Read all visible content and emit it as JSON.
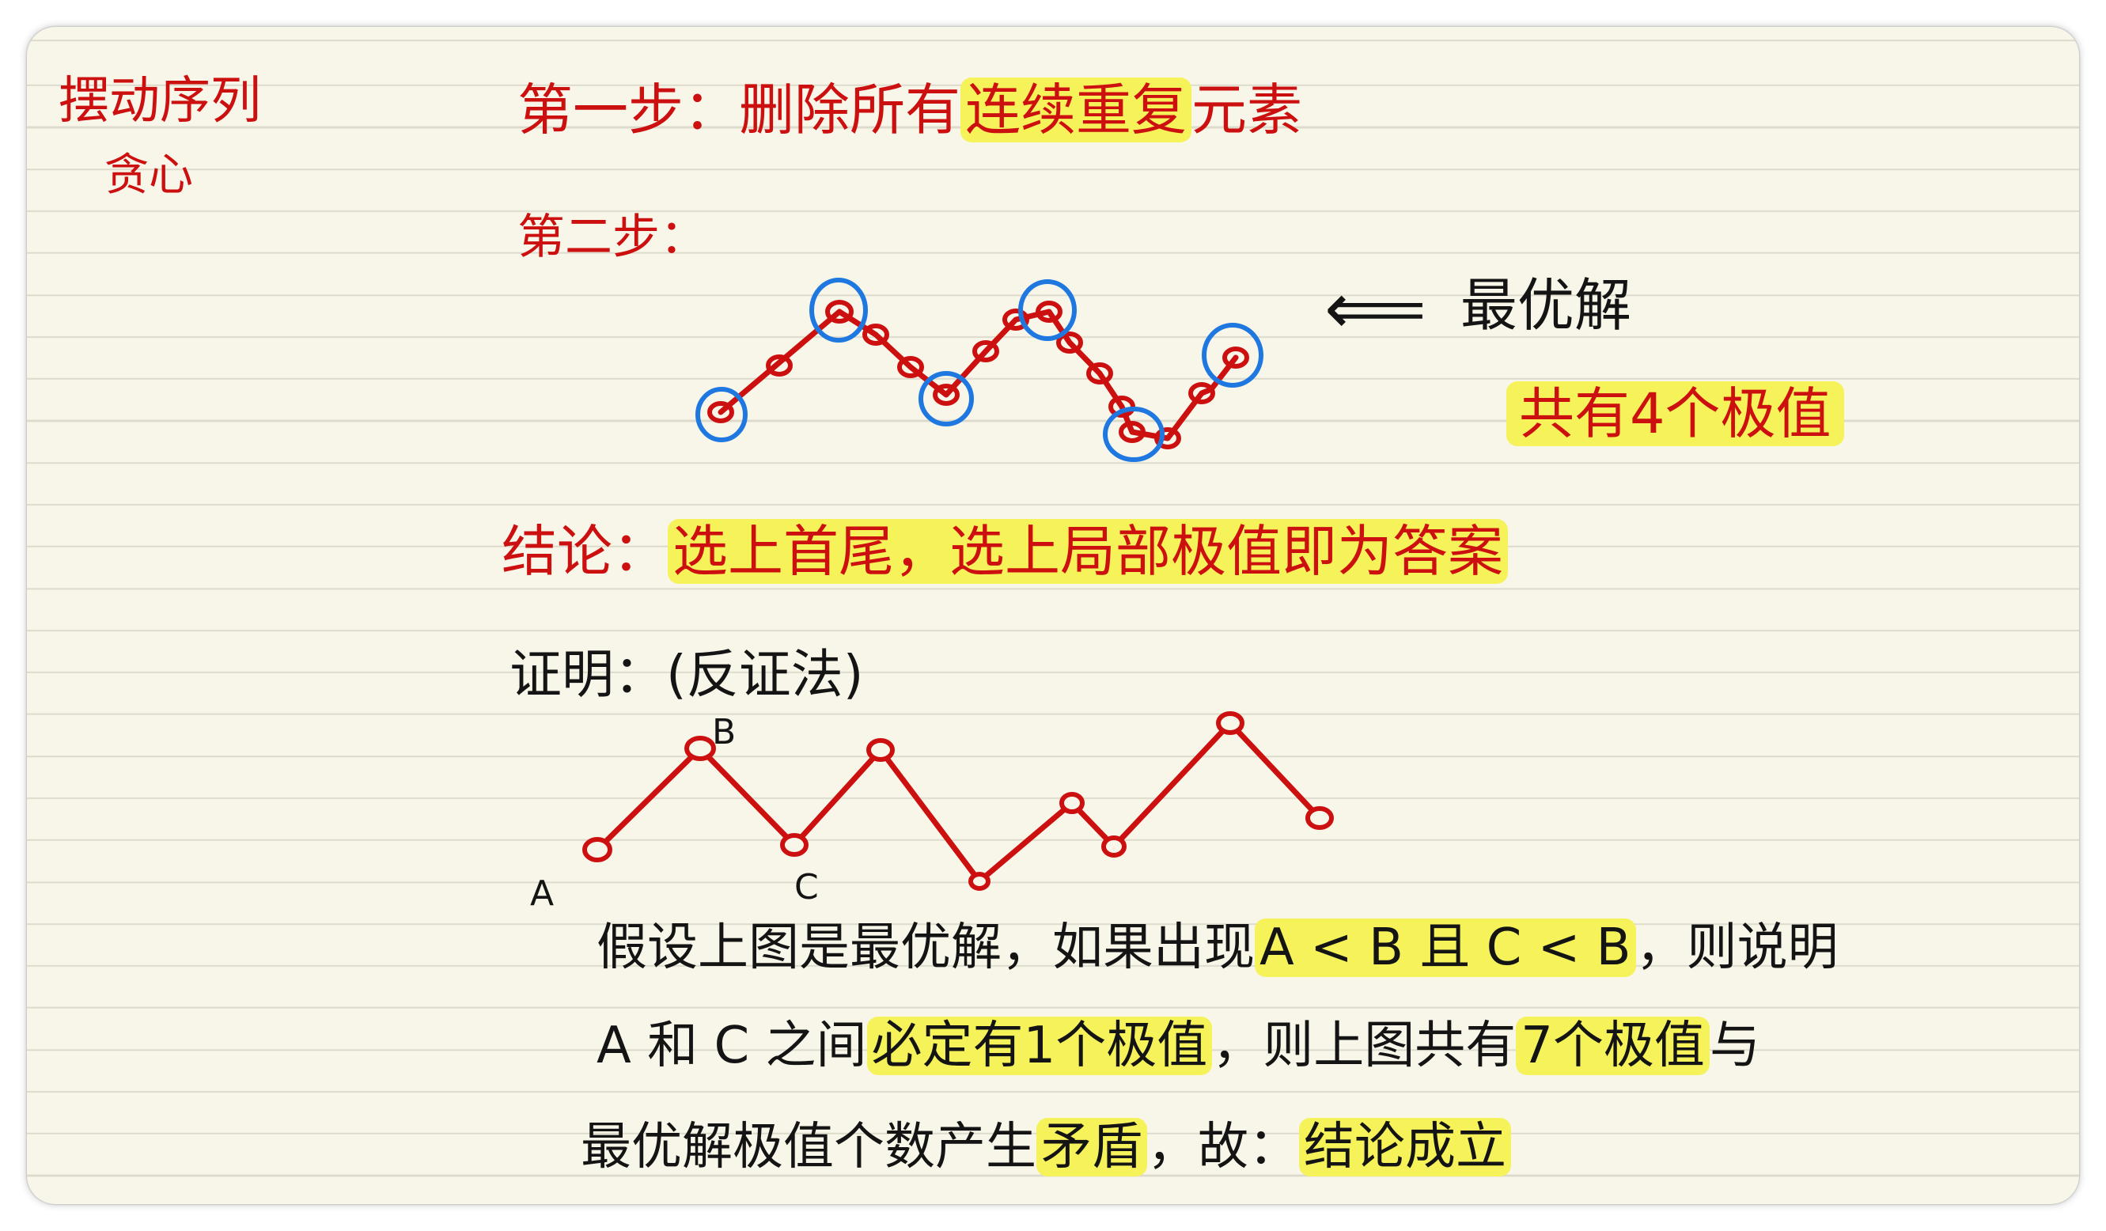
{
  "sidebar": {
    "line1": "摆动序列",
    "line2": "贪心"
  },
  "step1": {
    "prefix": "第一步：删除所有",
    "highlight": "连续重复",
    "suffix": "元素"
  },
  "step2": {
    "label": "第二步：",
    "arrow": "⟸",
    "optimal": "最优解",
    "extreme_count": "共有4个极值"
  },
  "conclusion": {
    "label": "结论：",
    "text": "选上首尾，选上局部极值即为答案"
  },
  "proof": {
    "label": "证明：(反证法)",
    "point_labels": {
      "a": "A",
      "b": "B",
      "c": "C"
    },
    "line1_prefix": "假设上图是最优解，如果出现",
    "line1_highlight": "A < B 且 C < B",
    "line1_suffix": "，则说明",
    "line2_prefix": "A 和 C 之间",
    "line2_highlight1": "必定有1个极值",
    "line2_mid": "，则上图共有",
    "line2_highlight2": "7个极值",
    "line2_suffix": "与",
    "line3_prefix": "最优解极值个数产生",
    "line3_highlight1": "矛盾",
    "line3_mid": "，故：",
    "line3_highlight2": "结论成立"
  },
  "colors": {
    "paper": "#f8f6e9",
    "ink_red": "#cc1010",
    "ink_black": "#141414",
    "circle_blue": "#1e78e0",
    "highlight": "#f6f25a",
    "rule_line": "#dcdacb"
  }
}
